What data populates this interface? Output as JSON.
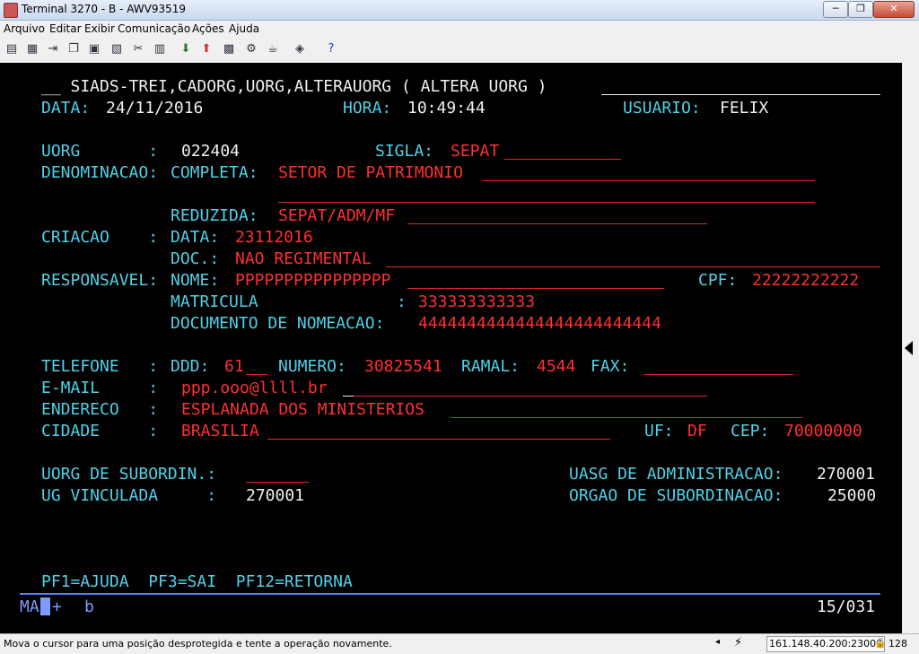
{
  "window": {
    "title": "Terminal 3270 - B - AWV93519",
    "minimize": "─",
    "restore": "❐",
    "close": "✕"
  },
  "menu": [
    "Arquivo",
    "Editar",
    "Exibir",
    "Comunicação",
    "Ações",
    "Ajuda"
  ],
  "toolbar_icons": [
    "print-icon",
    "print-screen-icon",
    "send-icon",
    "copy-icon",
    "paste-icon",
    "cut-icon",
    "keyboard-icon",
    "download-icon",
    "upload-icon",
    "macro-icon",
    "cup-icon",
    "settings-icon",
    "help-icon"
  ],
  "screen": {
    "header": "__ SIADS-TREI,CADORG,UORG,ALTERAUORG ( ALTERA UORG )",
    "data_label": "DATA:",
    "data_value": "24/11/2016",
    "hora_label": "HORA:",
    "hora_value": "10:49:44",
    "usuario_label": "USUARIO:",
    "usuario_value": "FELIX",
    "uorg_label": "UORG       :",
    "uorg_value": "022404",
    "sigla_label": "SIGLA:",
    "sigla_value": "SEPAT",
    "denominacao_label": "DENOMINACAO:",
    "completa_label": "COMPLETA:",
    "completa_value": "SETOR DE PATRIMONIO",
    "reduzida_label": "REDUZIDA:",
    "reduzida_value": "SEPAT/ADM/MF",
    "criacao_label": "CRIACAO    :",
    "criacao_data_label": "DATA:",
    "criacao_data_value": "23112016",
    "doc_label": "DOC.:",
    "doc_value": "NAO REGIMENTAL",
    "responsavel_label": "RESPONSAVEL:",
    "nome_label": "NOME:",
    "nome_value": "PPPPPPPPPPPPPPPP",
    "cpf_label": "CPF:",
    "cpf_value": "22222222222",
    "matricula_label": "MATRICULA",
    "matricula_colon": ":",
    "matricula_value": "333333333333",
    "doc_nomeacao_label": "DOCUMENTO DE NOMEACAO:",
    "doc_nomeacao_value": "4444444444444444444444444",
    "telefone_label": "TELEFONE   :",
    "ddd_label": "DDD:",
    "ddd_value": "61",
    "numero_label": "NUMERO:",
    "numero_value": "30825541",
    "ramal_label": "RAMAL:",
    "ramal_value": "4544",
    "fax_label": "FAX:",
    "email_label": "E-MAIL     :",
    "email_value": "ppp.ooo@llll.br",
    "endereco_label": "ENDERECO   :",
    "endereco_value": "ESPLANADA DOS MINISTERIOS",
    "cidade_label": "CIDADE     :",
    "cidade_value": "BRASILIA",
    "uf_label": "UF:",
    "uf_value": "DF",
    "cep_label": "CEP:",
    "cep_value": "70000000",
    "uorg_sub_label": "UORG DE SUBORDIN.:",
    "uasg_label": "UASG DE ADMINISTRACAO:",
    "uasg_value": "270001",
    "ug_label": "UG VINCULADA     :",
    "ug_value": "270001",
    "orgao_label": "ORGAO DE SUBORDINACAO:",
    "orgao_value": "25000",
    "pf_keys": "PF1=AJUDA  PF3=SAI  PF12=RETORNA"
  },
  "oia": {
    "ma": "MA",
    "plus": "+",
    "b": "b",
    "position": "15/031"
  },
  "status": {
    "message": "Mova o cursor para uma posição desprotegida e tente a operação novamente.",
    "host": "161.148.40.200:23000",
    "lock": "128"
  },
  "colors": {
    "terminal_bg": "#000000",
    "field_label": "#4fd2e8",
    "protected_value": "#f0f0f0",
    "input_value": "#ff3030",
    "oia": "#7f9bff"
  }
}
